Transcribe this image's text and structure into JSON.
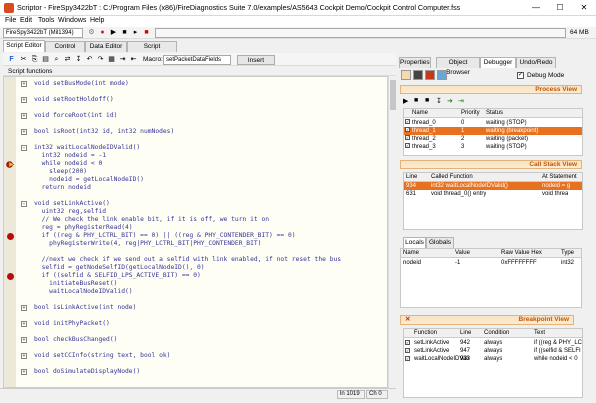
{
  "window": {
    "title": "Scriptor - FireSpy3422bT : C:/Program Files (x86)/FireDiagnostics Suite 7.0/examples/AS5643 Cockpit Demo/Cockpit Control Computer.fss",
    "min_label": "—",
    "max_label": "☐",
    "close_label": "✕"
  },
  "menu": [
    "File",
    "Edit",
    "Tools",
    "Windows",
    "Help"
  ],
  "toolbar": {
    "device": "FireSpy3422bT (Mil1394)",
    "memory": "64 MB"
  },
  "left_tabs": [
    "Script Editor",
    "Control Panel",
    "Data Editor",
    "Script Properties"
  ],
  "editor_toolbar": {
    "macro_label": "Macro:",
    "macro_value": "setPacketDataFields",
    "insert_label": "Insert"
  },
  "script_functions_label": "Script functions",
  "code_lines": [
    "void setBusMode(int mode)",
    "",
    "void setRootHoldoff()",
    "",
    "void forceRoot(int id)",
    "",
    "bool isRoot(int32 id, int32 numNodes)",
    "",
    "int32 waitLocalNodeIDValid()",
    "  int32 nodeid = -1",
    "  while nodeid < 0",
    "    sleep(200)",
    "    nodeid = getLocalNodeID()",
    "  return nodeid",
    "",
    "void setLinkActive()",
    "  uint32 reg,selfid",
    "  // We check the link enable bit, if it is off, we turn it on",
    "  reg = phyRegisterRead(4)",
    "  if ((reg & PHY_LCTRL_BIT) == 0) || ((reg & PHY_CONTENDER_BIT) == 0)",
    "    phyRegisterWrite(4, reg|PHY_LCTRL_BIT|PHY_CONTENDER_BIT)",
    "",
    "  //next we check if we send out a selfid with link enabled, if not reset the bus",
    "  selfid = getNodeSelfID(getLocalNodeID(), 0)",
    "  if ((selfid & SELFID_LPS_ACTIVE_BIT) == 0)",
    "    initiateBusReset()",
    "    waitLocalNodeIDValid()",
    "",
    "bool isLinkActive(int node)",
    "",
    "void initPhyPacket()",
    "",
    "bool checkBusChanged()",
    "",
    "void setCCInfo(string text, bool ok)",
    "",
    "bool doSimulateDisplayNode()"
  ],
  "status": {
    "line": "ln 1019",
    "col": "Ch 0"
  },
  "right_tabs": [
    "Properties",
    "Object Browser",
    "Debugger",
    "Undo/Redo"
  ],
  "debug_mode_label": "Debug Mode",
  "process_view": {
    "title": "Process View",
    "headers": [
      "Name",
      "Priority",
      "Status"
    ],
    "rows": [
      [
        "thread_0",
        "0",
        "waiting (STOP)"
      ],
      [
        "thread_1",
        "1",
        "waiting (breakpoint)"
      ],
      [
        "thread_2",
        "2",
        "waiting (packet)"
      ],
      [
        "thread_3",
        "3",
        "waiting (STOP)"
      ]
    ]
  },
  "call_stack": {
    "title": "Call Stack View",
    "headers": [
      "Line",
      "Called Function",
      "At Statement"
    ],
    "rows": [
      [
        "934",
        "int32 waitLocalNodeIDValid()",
        "nodeid = g"
      ],
      [
        "631",
        "void thread_0() entry",
        "void threa"
      ]
    ]
  },
  "bottom_tabs": [
    "Locals",
    "Globals"
  ],
  "locals": {
    "headers": [
      "Name",
      "Value",
      "Raw Value Hex",
      "Type"
    ],
    "rows": [
      [
        "nodeid",
        "-1",
        "0xFFFFFFFF",
        "int32"
      ]
    ]
  },
  "breakpoints": {
    "title": "Breakpoint View",
    "headers": [
      "Function",
      "Line",
      "Condition",
      "Text"
    ],
    "rows": [
      [
        "setLinkActive",
        "942",
        "always",
        "if ((reg & PHY_LC"
      ],
      [
        "setLinkActive",
        "947",
        "always",
        "if ((selfid & SELFI"
      ],
      [
        "waitLocalNodeIDVali",
        "933",
        "always",
        "while nodeid < 0"
      ]
    ]
  },
  "colors": {
    "accent": "#e8711f",
    "breakpoint": "#b21010",
    "panel_title": "#c0580a"
  }
}
